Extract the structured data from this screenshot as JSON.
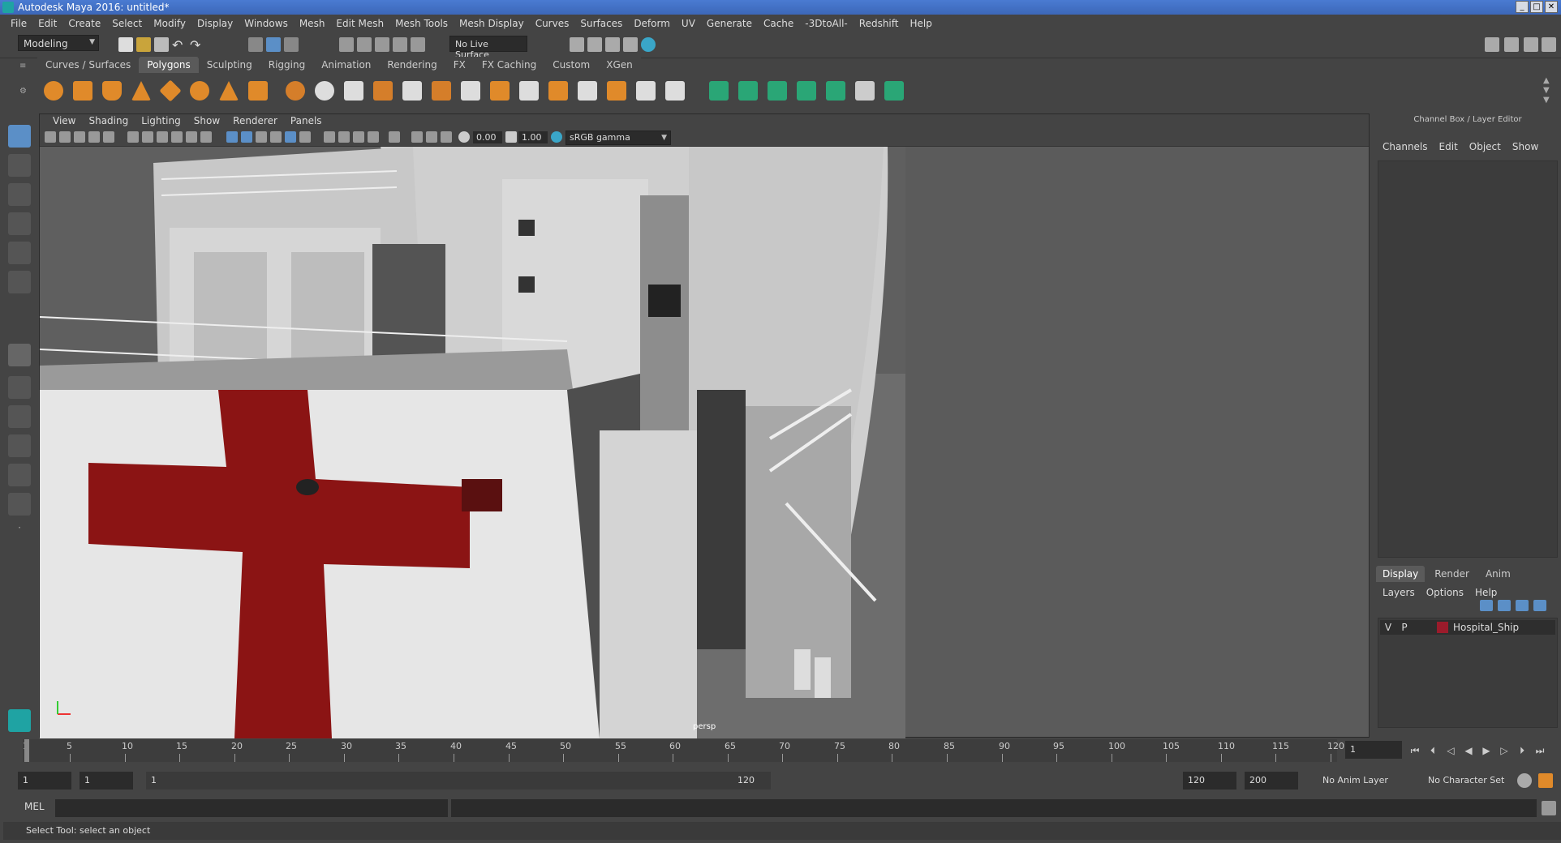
{
  "window": {
    "title": "Autodesk Maya 2016: untitled*",
    "min": "_",
    "max": "□",
    "close": "✕"
  },
  "menu": [
    "File",
    "Edit",
    "Create",
    "Select",
    "Modify",
    "Display",
    "Windows",
    "Mesh",
    "Edit Mesh",
    "Mesh Tools",
    "Mesh Display",
    "Curves",
    "Surfaces",
    "Deform",
    "UV",
    "Generate",
    "Cache",
    "-3DtoAll-",
    "Redshift",
    "Help"
  ],
  "status": {
    "menuset": "Modeling",
    "live_surface": "No Live Surface"
  },
  "shelf_tabs": [
    "Curves / Surfaces",
    "Polygons",
    "Sculpting",
    "Rigging",
    "Animation",
    "Rendering",
    "FX",
    "FX Caching",
    "Custom",
    "XGen"
  ],
  "shelf_active": "Polygons",
  "viewport": {
    "menu": [
      "View",
      "Shading",
      "Lighting",
      "Show",
      "Renderer",
      "Panels"
    ],
    "exposure": "0.00",
    "gamma": "1.00",
    "color_space": "sRGB gamma",
    "camera": "persp"
  },
  "channelbox": {
    "title": "Channel Box / Layer Editor",
    "menu": [
      "Channels",
      "Edit",
      "Object",
      "Show"
    ]
  },
  "layer_editor": {
    "tabs": [
      "Display",
      "Render",
      "Anim"
    ],
    "active_tab": "Display",
    "menu": [
      "Layers",
      "Options",
      "Help"
    ],
    "layer": {
      "v": "V",
      "p": "P",
      "name": "Hospital_Ship",
      "color": "#9b1b2b"
    }
  },
  "timeline": {
    "ticks": [
      "1",
      "5",
      "10",
      "15",
      "20",
      "25",
      "30",
      "35",
      "40",
      "45",
      "50",
      "55",
      "60",
      "65",
      "70",
      "75",
      "80",
      "85",
      "90",
      "95",
      "100",
      "105",
      "110",
      "115",
      "120"
    ],
    "current_frame": "1"
  },
  "range": {
    "start": "1",
    "playback_start": "1",
    "slider_start": "1",
    "slider_end": "120",
    "playback_end": "120",
    "end": "200",
    "anim_layer": "No Anim Layer",
    "character_set": "No Character Set"
  },
  "cmd": {
    "lang": "MEL"
  },
  "help": {
    "text": "Select Tool: select an object"
  }
}
